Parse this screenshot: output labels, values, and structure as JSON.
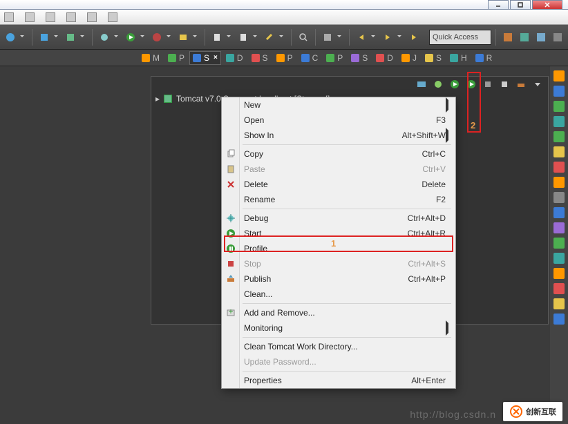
{
  "window": {
    "buttons": [
      "minimize",
      "maximize",
      "close"
    ]
  },
  "toolbar": {
    "buttons": [
      "new-project",
      "save-all",
      "build",
      "debug-config",
      "run",
      "ext-tools",
      "new-wiz",
      "search",
      "skip-bp",
      "step",
      "undo",
      "redo",
      "back",
      "forward"
    ],
    "quick_access_label": "Quick Access"
  },
  "editor_tabs": [
    {
      "icon": "c-orange",
      "label": "M"
    },
    {
      "icon": "c-green",
      "label": "P"
    },
    {
      "icon": "c-blue",
      "label": "S",
      "active": true,
      "close": true
    },
    {
      "icon": "c-teal",
      "label": "D"
    },
    {
      "icon": "c-red",
      "label": "S"
    },
    {
      "icon": "c-orange",
      "label": "P"
    },
    {
      "icon": "c-blue",
      "label": "C"
    },
    {
      "icon": "c-green",
      "label": "P"
    },
    {
      "icon": "c-purple",
      "label": "S"
    },
    {
      "icon": "c-red",
      "label": "D"
    },
    {
      "icon": "c-orange",
      "label": "J"
    },
    {
      "icon": "c-yellow",
      "label": "S"
    },
    {
      "icon": "c-teal",
      "label": "H"
    },
    {
      "icon": "c-blue",
      "label": "R"
    }
  ],
  "panel_toolbar": [
    "console-switch",
    "new-server",
    "start-debug",
    "start",
    "profile",
    "stop",
    "publish"
  ],
  "server": {
    "label": "Tomcat v7.0 Server at localhost  [Stopped]"
  },
  "context_menu": {
    "items": [
      {
        "label": "New",
        "submenu": true
      },
      {
        "label": "Open",
        "shortcut": "F3"
      },
      {
        "label": "Show In",
        "shortcut": "Alt+Shift+W",
        "submenu": true
      },
      {
        "sep": true
      },
      {
        "icon": "copy",
        "label": "Copy",
        "shortcut": "Ctrl+C"
      },
      {
        "icon": "paste",
        "label": "Paste",
        "shortcut": "Ctrl+V",
        "disabled": true
      },
      {
        "icon": "delete",
        "label": "Delete",
        "shortcut": "Delete"
      },
      {
        "label": "Rename",
        "shortcut": "F2"
      },
      {
        "sep": true
      },
      {
        "icon": "debug",
        "label": "Debug",
        "shortcut": "Ctrl+Alt+D"
      },
      {
        "icon": "start",
        "label": "Start",
        "shortcut": "Ctrl+Alt+R",
        "highlight": true
      },
      {
        "icon": "profile",
        "label": "Profile"
      },
      {
        "icon": "stop",
        "label": "Stop",
        "shortcut": "Ctrl+Alt+S",
        "disabled": true
      },
      {
        "icon": "publish",
        "label": "Publish",
        "shortcut": "Ctrl+Alt+P"
      },
      {
        "label": "Clean..."
      },
      {
        "sep": true
      },
      {
        "icon": "addremove",
        "label": "Add and Remove..."
      },
      {
        "label": "Monitoring",
        "submenu": true
      },
      {
        "sep": true
      },
      {
        "label": "Clean Tomcat Work Directory..."
      },
      {
        "label": "Update Password...",
        "disabled": true
      },
      {
        "sep": true
      },
      {
        "label": "Properties",
        "shortcut": "Alt+Enter"
      }
    ],
    "annotation1": "1"
  },
  "annotation2": "2",
  "rail_icons": [
    "c-orange",
    "c-blue",
    "c-green",
    "c-teal",
    "c-green",
    "c-yellow",
    "c-red",
    "c-orange",
    "c-gray",
    "c-blue",
    "c-purple",
    "c-green",
    "c-teal",
    "c-orange",
    "c-red",
    "c-yellow",
    "c-blue"
  ],
  "watermark": {
    "url_text": "http://blog.csdn.n",
    "logo_text": "创新互联"
  }
}
